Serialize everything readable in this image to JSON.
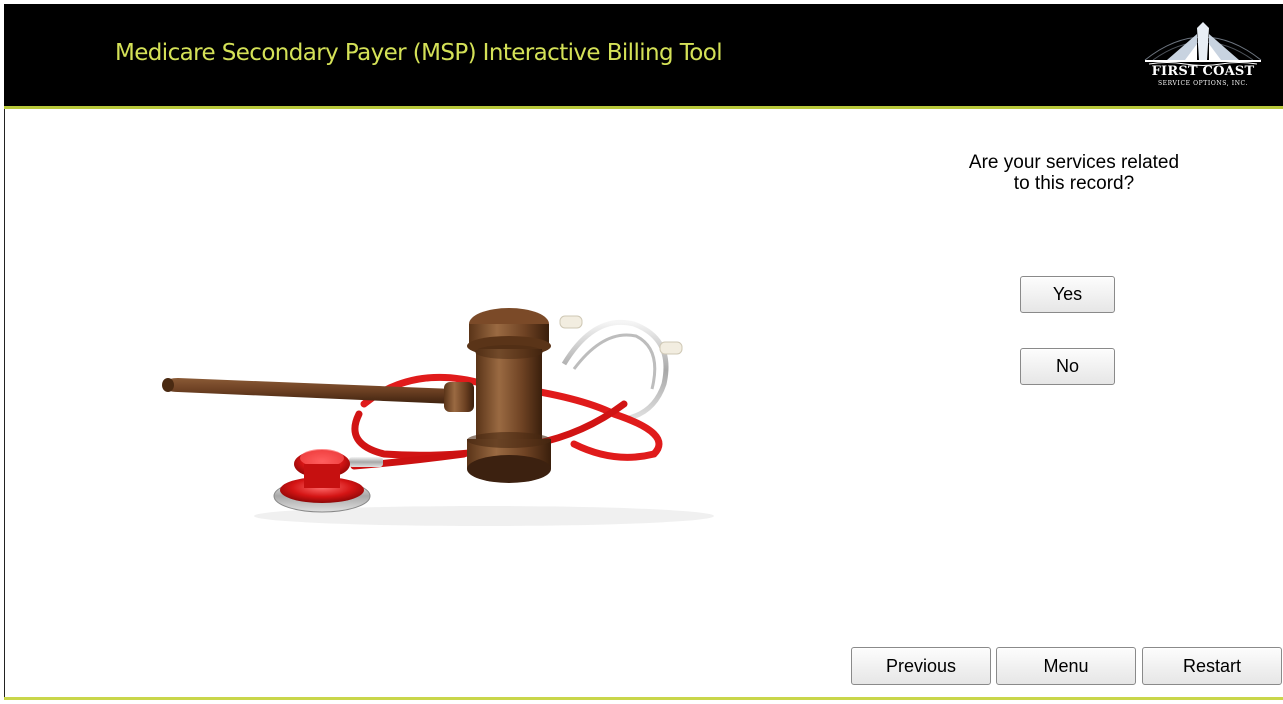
{
  "header": {
    "title": "Medicare Secondary Payer (MSP) Interactive Billing Tool",
    "logo_name": "FIRST COAST",
    "logo_sub": "SERVICE OPTIONS, INC.",
    "accent_color": "#d4e157",
    "background_color": "#000000"
  },
  "main": {
    "question_line1": "Are your services related",
    "question_line2": "to this record?",
    "image": "gavel-and-stethoscope",
    "yes_label": "Yes",
    "no_label": "No"
  },
  "footer": {
    "previous_label": "Previous",
    "menu_label": "Menu",
    "restart_label": "Restart",
    "bar_color": "#c9d64a"
  }
}
